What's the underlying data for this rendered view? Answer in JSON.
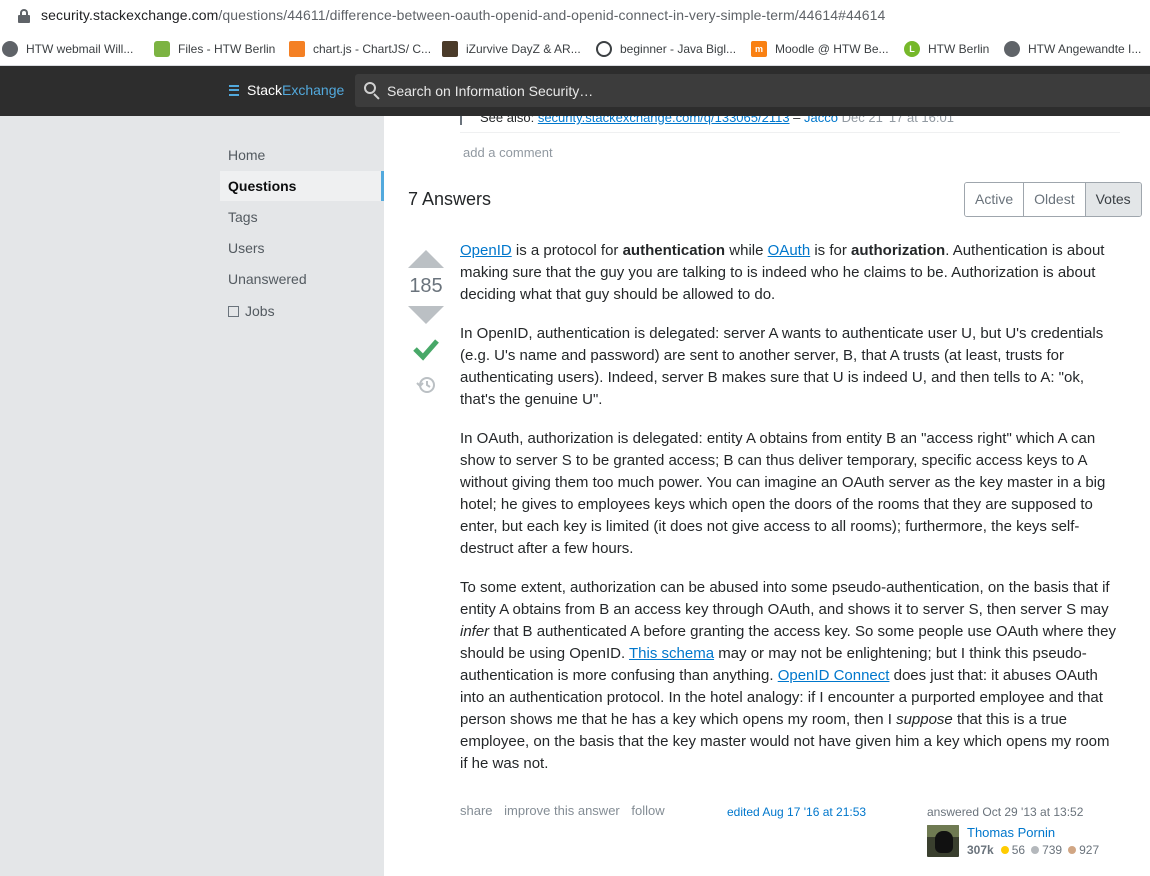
{
  "browser": {
    "url_host": "security.stackexchange.com",
    "url_path": "/questions/44611/difference-between-oauth-openid-and-openid-connect-in-very-simple-term/44614#44614",
    "bookmarks": [
      {
        "label": "HTW webmail  Will...",
        "icon_color": "#5f6368"
      },
      {
        "label": "Files - HTW Berlin",
        "icon_color": "#7cb342"
      },
      {
        "label": "chart.js - ChartJS/ C...",
        "icon_color": "#f48024"
      },
      {
        "label": "iZurvive DayZ & AR...",
        "icon_color": "#4b3b2a"
      },
      {
        "label": "beginner - Java Bigl...",
        "icon_color": "#5f6368"
      },
      {
        "label": "Moodle @ HTW Be...",
        "icon_color": "#f98012"
      },
      {
        "label": "HTW Berlin",
        "icon_color": "#76b82a"
      },
      {
        "label": "HTW Angewandte I...",
        "icon_color": "#5f6368"
      }
    ]
  },
  "topbar": {
    "logo_stack": "Stack",
    "logo_exchange": "Exchange",
    "search_placeholder": "Search on Information Security…"
  },
  "leftnav": {
    "items": [
      "Home",
      "Questions",
      "Tags",
      "Users",
      "Unanswered",
      "Jobs"
    ],
    "active": "Questions"
  },
  "prev_comment": {
    "text": "See also: ",
    "link": "security.stackexchange.com/q/133065/2113",
    "dash": " – ",
    "user": "Jacco",
    "date": " Dec 21 '17 at 16:01"
  },
  "add_comment": "add a comment",
  "answers_header": "7 Answers",
  "sort_tabs": [
    "Active",
    "Oldest",
    "Votes"
  ],
  "answer": {
    "votes": "185",
    "accepted": true,
    "p1": {
      "a1": "OpenID",
      "t1": " is a protocol for ",
      "b1": "authentication",
      "t2": " while ",
      "a2": "OAuth",
      "t3": " is for ",
      "b2": "authorization",
      "t4": ". Authentication is about making sure that the guy you are talking to is indeed who he claims to be. Authorization is about deciding what that guy should be allowed to do."
    },
    "p2": "In OpenID, authentication is delegated: server A wants to authenticate user U, but U's credentials (e.g. U's name and password) are sent to another server, B, that A trusts (at least, trusts for authenticating users). Indeed, server B makes sure that U is indeed U, and then tells to A: \"ok, that's the genuine U\".",
    "p3": "In OAuth, authorization is delegated: entity A obtains from entity B an \"access right\" which A can show to server S to be granted access; B can thus deliver temporary, specific access keys to A without giving them too much power. You can imagine an OAuth server as the key master in a big hotel; he gives to employees keys which open the doors of the rooms that they are supposed to enter, but each key is limited (it does not give access to all rooms); furthermore, the keys self-destruct after a few hours.",
    "p4": {
      "t1": "To some extent, authorization can be abused into some pseudo-authentication, on the basis that if entity A obtains from B an access key through OAuth, and shows it to server S, then server S may ",
      "i1": "infer",
      "t2": " that B authenticated A before granting the access key. So some people use OAuth where they should be using OpenID. ",
      "a1": "This schema",
      "t3": " may or may not be enlightening; but I think this pseudo-authentication is more confusing than anything. ",
      "a2": "OpenID Connect",
      "t4": " does just that: it abuses OAuth into an authentication protocol. In the hotel analogy: if I encounter a purported employee and that person shows me that he has a key which opens my room, then I ",
      "i2": "suppose",
      "t5": " that this is a true employee, on the basis that the key master would not have given him a key which opens my room if he was not."
    },
    "menu": [
      "share",
      "improve this answer",
      "follow"
    ],
    "edited": "edited Aug 17 '16 at 21:53",
    "answered": "answered Oct 29 '13 at 13:52",
    "user": {
      "name": "Thomas Pornin",
      "rep": "307k",
      "gold": "56",
      "silver": "739",
      "bronze": "927"
    }
  }
}
